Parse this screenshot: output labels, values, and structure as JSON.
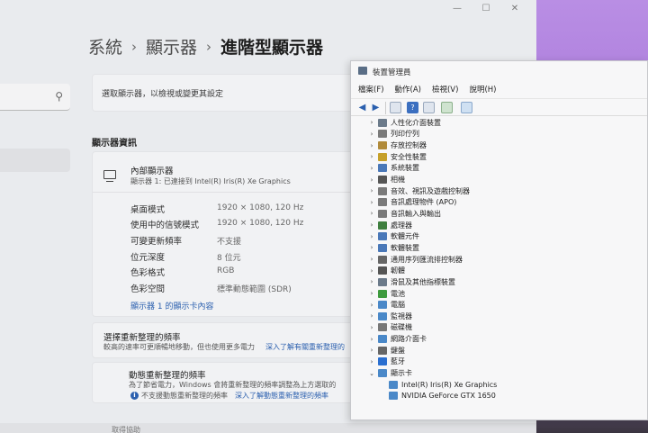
{
  "settings": {
    "window_controls": [
      "—",
      "☐",
      "✕"
    ],
    "breadcrumb": [
      "系統",
      "顯示器",
      "進階型顯示器"
    ],
    "select_display_label": "選取顯示器，以檢視或變更其設定",
    "display_info_title": "顯示器資訊",
    "display_name": "內部顯示器",
    "display_connection": "顯示器 1: 已連接到 Intel(R) Iris(R) Xe Graphics",
    "rows": [
      {
        "label": "桌面模式",
        "value": "1920 × 1080, 120 Hz"
      },
      {
        "label": "使用中的信號模式",
        "value": "1920 × 1080, 120 Hz"
      },
      {
        "label": "可變更新頻率",
        "value": "不支援"
      },
      {
        "label": "位元深度",
        "value": "8 位元"
      },
      {
        "label": "色彩格式",
        "value": "RGB"
      },
      {
        "label": "色彩空間",
        "value": "標準動態範圍 (SDR)"
      }
    ],
    "adapter_link": "顯示器 1 的顯示卡內容",
    "refresh_title": "選擇重新整理的頻率",
    "refresh_desc": "較高的速率可更順暢地移動，但也使用更多電力",
    "refresh_link": "深入了解有關重新整理的",
    "dynamic_title": "動態重新整理的頻率",
    "dynamic_desc": "為了節省電力，Windows 會將重新整理的頻率調整為上方選取的",
    "dynamic_note": "不支援動態重新整理的頻率",
    "dynamic_link": "深入了解動態重新整理的頻率",
    "bottom_partial": "取得協助"
  },
  "device_manager": {
    "title": "裝置管理員",
    "menus": [
      "檔案(F)",
      "動作(A)",
      "檢視(V)",
      "說明(H)"
    ],
    "categories": [
      {
        "label": "人性化介面裝置",
        "color": "#6b7a8a"
      },
      {
        "label": "列印佇列",
        "color": "#7a7a7a"
      },
      {
        "label": "存放控制器",
        "color": "#b08a3a"
      },
      {
        "label": "安全性裝置",
        "color": "#c6a02a"
      },
      {
        "label": "系統裝置",
        "color": "#4a78b8"
      },
      {
        "label": "相機",
        "color": "#555555"
      },
      {
        "label": "音效、視訊及遊戲控制器",
        "color": "#7a7a7a"
      },
      {
        "label": "音訊處理物件 (APO)",
        "color": "#7a7a7a"
      },
      {
        "label": "音訊輸入與輸出",
        "color": "#7a7a7a"
      },
      {
        "label": "處理器",
        "color": "#3f7f3f"
      },
      {
        "label": "軟體元件",
        "color": "#4a78b8"
      },
      {
        "label": "軟體裝置",
        "color": "#4a78b8"
      },
      {
        "label": "通用序列匯流排控制器",
        "color": "#666666"
      },
      {
        "label": "韌體",
        "color": "#555555"
      },
      {
        "label": "滑鼠及其他指標裝置",
        "color": "#6b7a8a"
      },
      {
        "label": "電池",
        "color": "#3e9a3e"
      },
      {
        "label": "電腦",
        "color": "#4a88c8"
      },
      {
        "label": "監視器",
        "color": "#4a88c8"
      },
      {
        "label": "磁碟機",
        "color": "#777777"
      },
      {
        "label": "網路介面卡",
        "color": "#4a88c8"
      },
      {
        "label": "鍵盤",
        "color": "#666666"
      },
      {
        "label": "藍牙",
        "color": "#2a6fd0"
      },
      {
        "label": "顯示卡",
        "color": "#4a88c8"
      }
    ],
    "display_adapters": [
      "Intel(R) Iris(R) Xe Graphics",
      "NVIDIA GeForce GTX 1650"
    ]
  }
}
